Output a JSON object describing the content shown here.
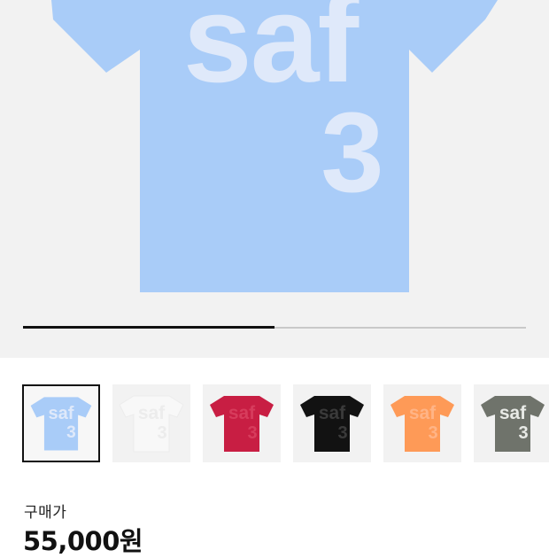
{
  "product": {
    "graphic_line1": "saf",
    "graphic_line2": "3",
    "image_progress_fraction": 0.5,
    "selected_color_index": 0
  },
  "color_options": [
    {
      "name": "light-blue",
      "shirt": "#a9ccf8",
      "print": "#dfe9fa"
    },
    {
      "name": "white",
      "shirt": "#f7f7f7",
      "print": "#ffffff"
    },
    {
      "name": "red",
      "shirt": "#c81e43",
      "print": "#d73c5c"
    },
    {
      "name": "black",
      "shirt": "#121212",
      "print": "#3a3a3a"
    },
    {
      "name": "orange",
      "shirt": "#fe9a57",
      "print": "#ffb486"
    },
    {
      "name": "khaki-gray",
      "shirt": "#6f736b",
      "print": "#e8eae6"
    }
  ],
  "price": {
    "label": "구매가",
    "value": "55,000원"
  },
  "colors": {
    "hero_background": "#f2f2f2",
    "hero_shirt": "#a9ccf8",
    "hero_print": "#dfe9fa"
  }
}
